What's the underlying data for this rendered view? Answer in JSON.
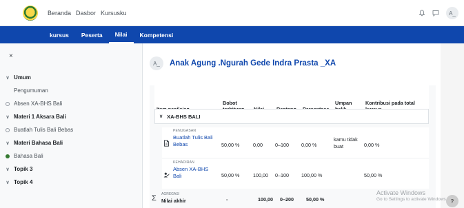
{
  "topbar": {
    "nav": [
      "Beranda",
      "Dasbor",
      "Kursusku"
    ],
    "avatar": "A_"
  },
  "subnav": {
    "tabs": [
      {
        "label": "kursus",
        "active": false
      },
      {
        "label": "Peserta",
        "active": false
      },
      {
        "label": "Nilai",
        "active": true
      },
      {
        "label": "Kompetensi",
        "active": false
      }
    ]
  },
  "drawer": {
    "close": "×",
    "items": [
      {
        "label": "Umum",
        "kind": "section"
      },
      {
        "label": "Pengumuman",
        "kind": "indent"
      },
      {
        "label": "Absen XA-BHS Bali",
        "kind": "circle"
      },
      {
        "label": "Materi 1 Aksara Bali",
        "kind": "section"
      },
      {
        "label": "Buatlah Tulis Bali Bebas",
        "kind": "circle"
      },
      {
        "label": "Materi Bahasa Bali",
        "kind": "section"
      },
      {
        "label": "Bahasa Bali",
        "kind": "dot"
      },
      {
        "label": "Topik 3",
        "kind": "section"
      },
      {
        "label": "Topik 4",
        "kind": "section"
      }
    ]
  },
  "user": {
    "initials": "A_",
    "name": "Anak Agung .Ngurah Gede Indra Prasta _XA"
  },
  "table": {
    "headers": {
      "item": "Item penilaian",
      "weight": "Bobot terhitung",
      "grade": "Nilai",
      "range": "Rentang",
      "percent": "Persentase",
      "feedback": "Umpan balik",
      "contrib": "Kontribusi pada total kursus"
    },
    "category": "XA-BHS BALI",
    "rows": [
      {
        "type": "PENUGASAN",
        "name": "Buatlah Tulis Bali Bebas",
        "weight": "50,00 %",
        "grade": "0,00",
        "range": "0–100",
        "percent": "0,00 %",
        "feedback": "kamu tidak buat",
        "contrib": "0,00 %"
      },
      {
        "type": "KEHADIRAN",
        "name": "Absen XA-BHS Bali",
        "weight": "50,00 %",
        "grade": "100,00",
        "range": "0–100",
        "percent": "100,00 %",
        "feedback": "",
        "contrib": "50,00 %"
      }
    ],
    "total": {
      "type": "AGREGASI",
      "label": "Nilai akhir",
      "weight": "-",
      "grade": "100,00",
      "range": "0–200",
      "percent": "50,00 %"
    }
  },
  "watermark": {
    "title": "Activate Windows",
    "subtitle": "Go to Settings to activate Windows."
  },
  "help": "?"
}
